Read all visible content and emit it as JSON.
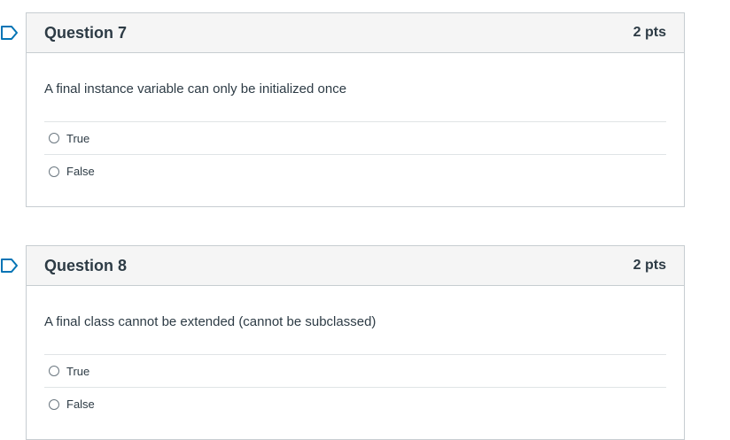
{
  "questions": [
    {
      "title": "Question 7",
      "points": "2 pts",
      "text": "A final instance variable can only be initialized once",
      "answers": [
        {
          "label": "True",
          "selected": false
        },
        {
          "label": "False",
          "selected": false
        }
      ]
    },
    {
      "title": "Question 8",
      "points": "2 pts",
      "text": "A final class cannot be extended (cannot be subclassed)",
      "answers": [
        {
          "label": "True",
          "selected": false
        },
        {
          "label": "False",
          "selected": false
        }
      ]
    }
  ],
  "colors": {
    "flag": "#0374b5",
    "header_bg": "#f5f5f5",
    "border": "#c7cdd1",
    "text": "#2d3b45"
  },
  "icons": {
    "flag": "flag-icon",
    "radio": "radio-button"
  }
}
